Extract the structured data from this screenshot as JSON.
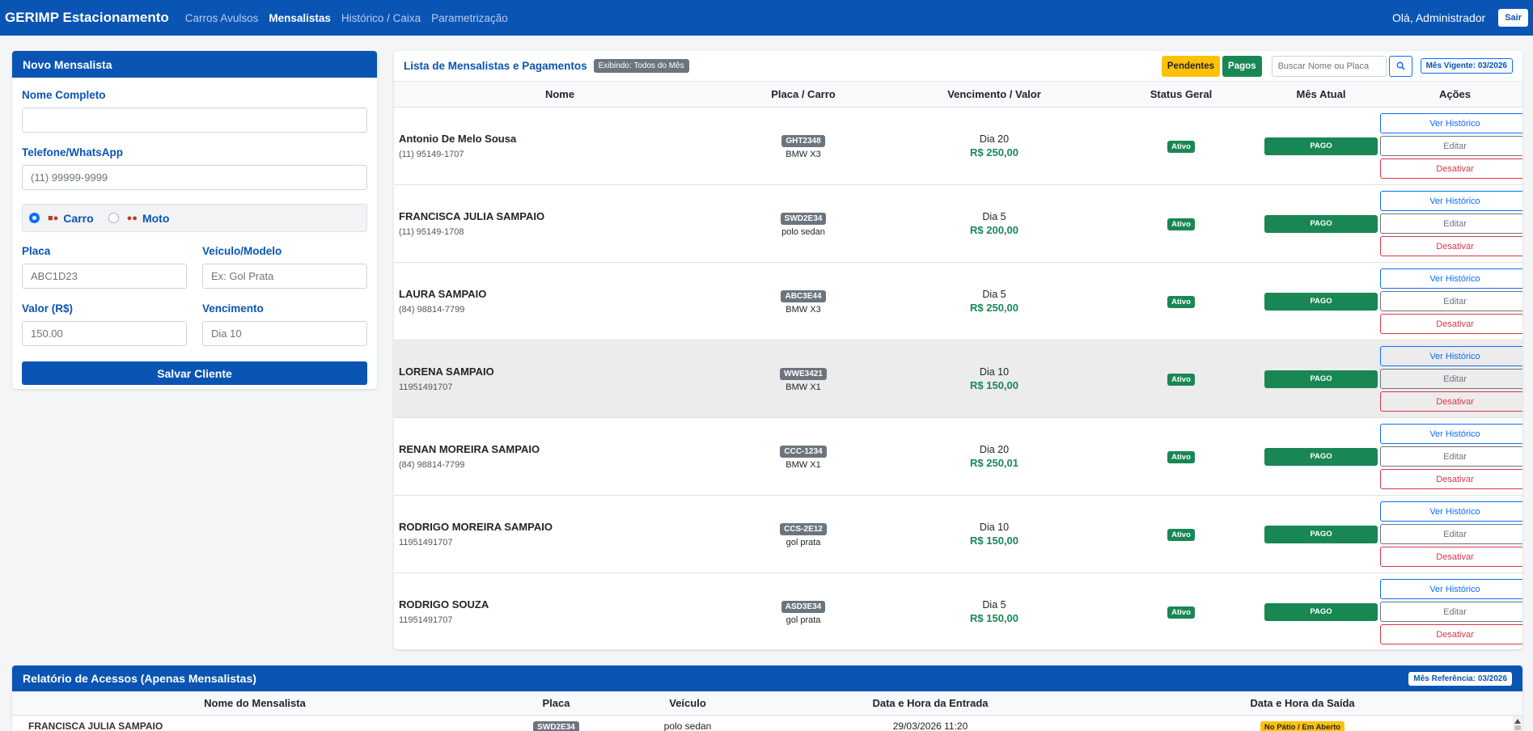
{
  "navbar": {
    "brand": "GERIMP Estacionamento",
    "links": [
      "Carros Avulsos",
      "Mensalistas",
      "Histórico / Caixa",
      "Parametrização"
    ],
    "greeting": "Olá, Administrador",
    "logout": "Sair"
  },
  "form": {
    "title": "Novo Mensalista",
    "nome_label": "Nome Completo",
    "nome_value": "",
    "telefone_label": "Telefone/WhatsApp",
    "telefone_placeholder": "(11) 99999-9999",
    "tipo_carro": "Carro",
    "tipo_moto": "Moto",
    "placa_label": "Placa",
    "placa_placeholder": "ABC1D23",
    "veiculo_label": "Veículo/Modelo",
    "veiculo_placeholder": "Ex: Gol Prata",
    "valor_label": "Valor (R$)",
    "valor_placeholder": "150.00",
    "vencimento_label": "Vencimento",
    "vencimento_placeholder": "Dia 10",
    "save_label": "Salvar Cliente"
  },
  "list": {
    "title": "Lista de Mensalistas e Pagamentos",
    "filter_badge": "Exibindo: Todos do Mês",
    "btn_pendentes": "Pendentes",
    "btn_pagos": "Pagos",
    "search_placeholder": "Buscar Nome ou Placa",
    "mes_vigente": "Mês Vigente: 03/2026",
    "columns": [
      "Nome",
      "Placa / Carro",
      "Vencimento / Valor",
      "Status Geral",
      "Mês Atual",
      "Ações"
    ],
    "actions": {
      "hist": "Ver Histórico",
      "edit": "Editar",
      "des": "Desativar"
    },
    "rows": [
      {
        "nome": "Antonio De Melo Sousa",
        "telefone": "(11) 95149-1707",
        "placa": "GHT2348",
        "carro": "BMW X3",
        "dia": "Dia 20",
        "valor": "R$ 250,00",
        "status": "Ativo",
        "mes": "PAGO"
      },
      {
        "nome": "FRANCISCA JULIA SAMPAIO",
        "telefone": "(11) 95149-1708",
        "placa": "SWD2E34",
        "carro": "polo sedan",
        "dia": "Dia 5",
        "valor": "R$ 200,00",
        "status": "Ativo",
        "mes": "PAGO"
      },
      {
        "nome": "LAURA SAMPAIO",
        "telefone": "(84) 98814-7799",
        "placa": "ABC3E44",
        "carro": "BMW X3",
        "dia": "Dia 5",
        "valor": "R$ 250,00",
        "status": "Ativo",
        "mes": "PAGO"
      },
      {
        "nome": "LORENA SAMPAIO",
        "telefone": "11951491707",
        "placa": "WWE3421",
        "carro": "BMW X1",
        "dia": "Dia 10",
        "valor": "R$ 150,00",
        "status": "Ativo",
        "mes": "PAGO"
      },
      {
        "nome": "RENAN MOREIRA SAMPAIO",
        "telefone": "(84) 98814-7799",
        "placa": "CCC-1234",
        "carro": "BMW X1",
        "dia": "Dia 20",
        "valor": "R$ 250,01",
        "status": "Ativo",
        "mes": "PAGO"
      },
      {
        "nome": "RODRIGO MOREIRA SAMPAIO",
        "telefone": "11951491707",
        "placa": "CCS-2E12",
        "carro": "gol prata",
        "dia": "Dia 10",
        "valor": "R$ 150,00",
        "status": "Ativo",
        "mes": "PAGO"
      },
      {
        "nome": "RODRIGO SOUZA",
        "telefone": "11951491707",
        "placa": "ASD3E34",
        "carro": "gol prata",
        "dia": "Dia 5",
        "valor": "R$ 150,00",
        "status": "Ativo",
        "mes": "PAGO"
      }
    ]
  },
  "report": {
    "title": "Relatório de Acessos (Apenas Mensalistas)",
    "mes_ref": "Mês Referência: 03/2026",
    "columns": [
      "Nome do Mensalista",
      "Placa",
      "Veículo",
      "Data e Hora da Entrada",
      "Data e Hora da Saída"
    ],
    "first_row": {
      "nome": "FRANCISCA JULIA SAMPAIO",
      "placa": "SWD2E34",
      "veiculo": "polo sedan",
      "entrada": "29/03/2026 11:20",
      "saida": "No Pátio / Em Aberto"
    }
  }
}
